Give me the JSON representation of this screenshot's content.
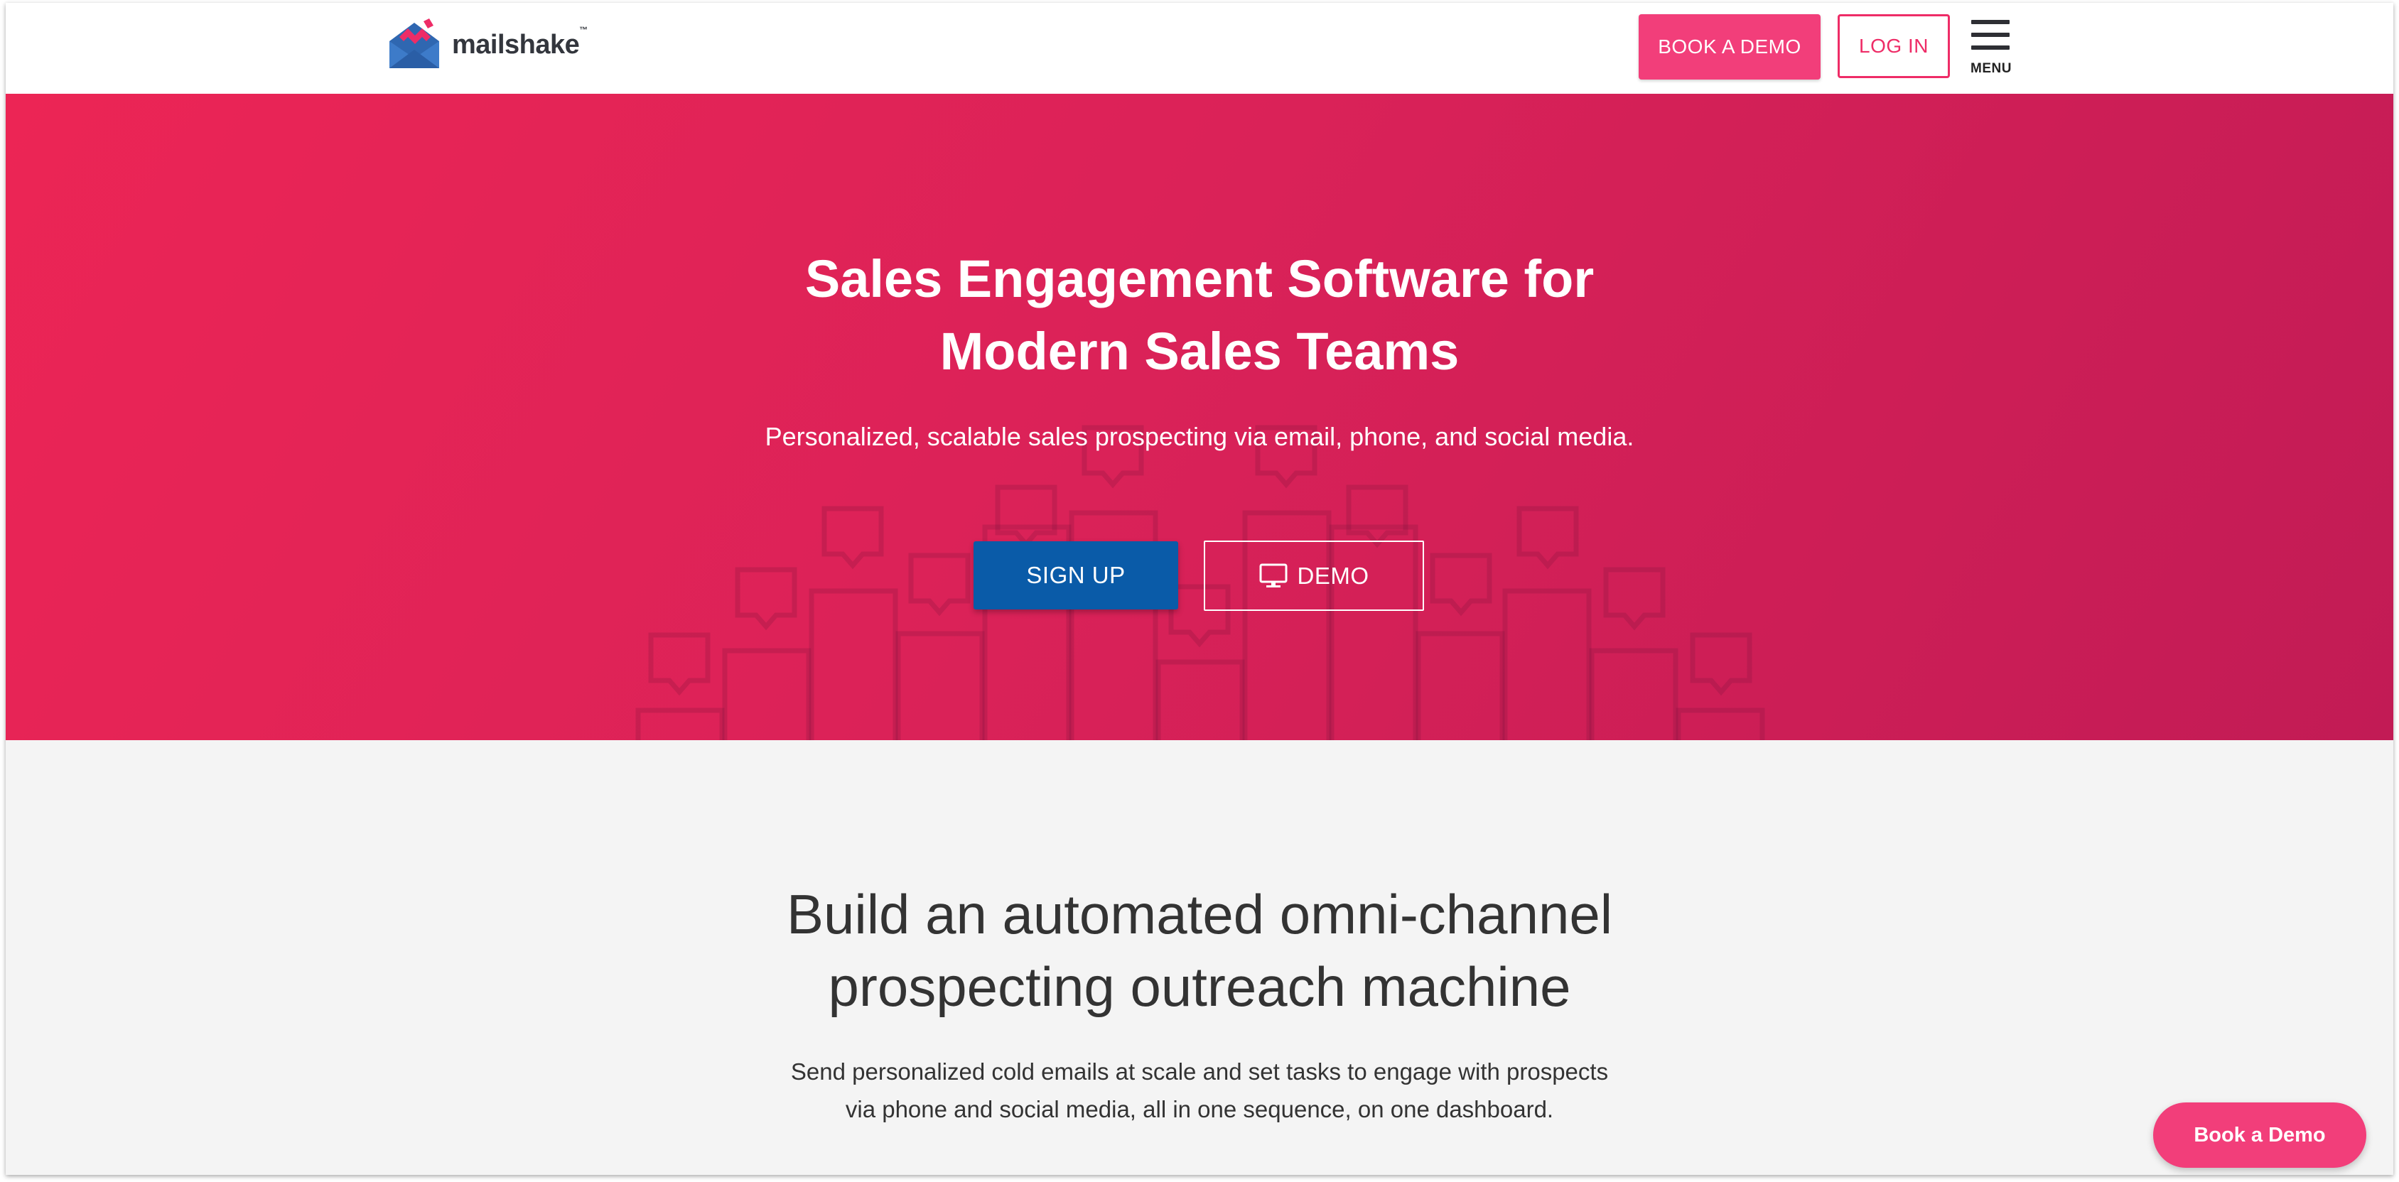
{
  "header": {
    "logo_text": "mailshake",
    "logo_tm": "™",
    "book_demo_label": "BOOK A DEMO",
    "login_label": "LOG IN",
    "menu_label": "MENU"
  },
  "hero": {
    "title_line1": "Sales Engagement Software for",
    "title_line2": "Modern Sales Teams",
    "subtitle": "Personalized, scalable sales prospecting via email, phone, and social media.",
    "signup_label": "SIGN UP",
    "demo_label": "DEMO",
    "demo_icon": "monitor-icon"
  },
  "section2": {
    "title_line1": "Build an automated omni-channel",
    "title_line2": "prospecting outreach machine",
    "body_line1": "Send personalized cold emails at scale and set tasks to engage with prospects",
    "body_line2": "via phone and social media, all in one sequence, on one dashboard."
  },
  "floating": {
    "book_demo_label": "Book a Demo"
  },
  "colors": {
    "brand_pink": "#f23e7a",
    "hero_gradient_start": "#ec2555",
    "hero_gradient_end": "#c21b55",
    "signup_blue": "#0a5ba8",
    "section_bg": "#f4f4f4"
  }
}
